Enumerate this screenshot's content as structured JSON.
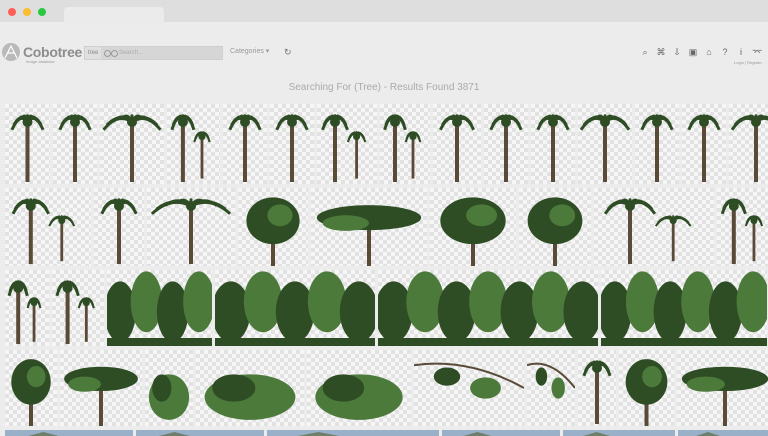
{
  "site": {
    "name": "Cobotree",
    "tagline": "Image database"
  },
  "search": {
    "tag": "tree",
    "placeholder": "Search...",
    "categories_label": "Categories ▾"
  },
  "header": {
    "login_label": "Login",
    "register_label": "Register",
    "separator": "|"
  },
  "results": {
    "text": "Searching For (Tree) - Results Found 3871"
  },
  "toolbar": [
    {
      "icon": "search-icon",
      "glyph": "⌕"
    },
    {
      "icon": "cart-icon",
      "glyph": "⌘"
    },
    {
      "icon": "download-icon",
      "glyph": "⇩"
    },
    {
      "icon": "archive-icon",
      "glyph": "▣"
    },
    {
      "icon": "education-icon",
      "glyph": "⌂"
    },
    {
      "icon": "help-icon",
      "glyph": "?"
    },
    {
      "icon": "info-icon",
      "glyph": "i"
    },
    {
      "icon": "share-icon",
      "glyph": "⌤"
    }
  ],
  "rows": [
    {
      "thumbs": [
        "palm",
        "palm",
        "palm-wide",
        "palm-pair",
        "palm",
        "palm",
        "palm-pair",
        "palm-pair",
        "palm",
        "palm",
        "palm",
        "palm-wide",
        "palm",
        "palm",
        "palm-wide"
      ]
    },
    {
      "thumbs": [
        "palm-pair",
        "palm",
        "palm-wide",
        "tree",
        "pine",
        "tree",
        "tree",
        "palm-pair",
        "palm-pair"
      ]
    },
    {
      "thumbs": [
        "palm-pair",
        "palm-pair",
        "forest",
        "forest",
        "forest",
        "forest"
      ]
    },
    {
      "thumbs": [
        "tree",
        "pine",
        "bush",
        "bush",
        "bush",
        "branch",
        "branch",
        "palm",
        "tree",
        "pine"
      ]
    },
    {
      "thumbs": [
        "photo",
        "photo",
        "photo",
        "photo",
        "photo",
        "photo"
      ]
    }
  ],
  "colors": {
    "foliage": "#2e4d25",
    "foliage_light": "#4c7a3a",
    "trunk": "#5a4a38",
    "sky": "#9ab0c8"
  }
}
